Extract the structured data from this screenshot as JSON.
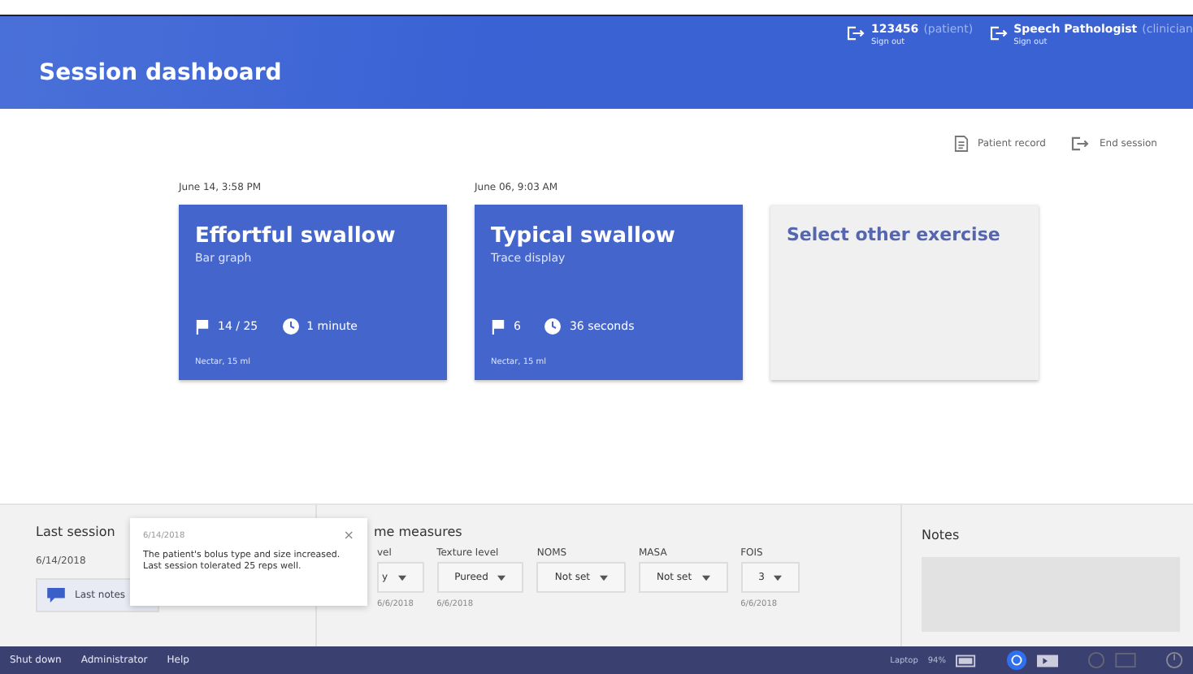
{
  "header": {
    "title": "Session dashboard",
    "accounts": [
      {
        "name": "123456",
        "role": "(patient)",
        "action": "Sign out"
      },
      {
        "name": "Speech Pathologist",
        "role": "(clinician",
        "action": "Sign out"
      }
    ]
  },
  "actions": [
    "Patient record",
    "End session"
  ],
  "exercises": [
    {
      "kind": "session",
      "date": "June 14, 3:58 PM",
      "title": "Effortful swallow",
      "subtitle": "Bar graph",
      "reps": "14 / 25",
      "duration": "1 minute",
      "bolus": "Nectar, 15 ml"
    },
    {
      "kind": "session",
      "date": "June 06, 9:03 AM",
      "title": "Typical swallow",
      "subtitle": "Trace display",
      "reps": "6",
      "duration": "36 seconds",
      "bolus": "Nectar, 15 ml"
    },
    {
      "kind": "select",
      "title": "Select other exercise"
    }
  ],
  "last_session": {
    "title": "Last session",
    "date": "6/14/2018",
    "button": "Last notes"
  },
  "popup": {
    "date": "6/14/2018",
    "close": "×",
    "text": "The patient's bolus type and size increased. Last session tolerated 25 reps well."
  },
  "outcome": {
    "title": "me measures",
    "measures": [
      {
        "label": "vel",
        "value": "y",
        "date": "6/6/2018"
      },
      {
        "label": "Texture level",
        "value": "Pureed",
        "date": "6/6/2018"
      },
      {
        "label": "NOMS",
        "value": "Not set"
      },
      {
        "label": "MASA",
        "value": "Not set"
      },
      {
        "label": "FOIS",
        "value": "3",
        "date": "6/6/2018"
      }
    ]
  },
  "notes": {
    "title": "Notes"
  },
  "footer": {
    "links": [
      "Shut down",
      "Administrator",
      "Help"
    ],
    "device": "Laptop",
    "battery": "94%"
  }
}
